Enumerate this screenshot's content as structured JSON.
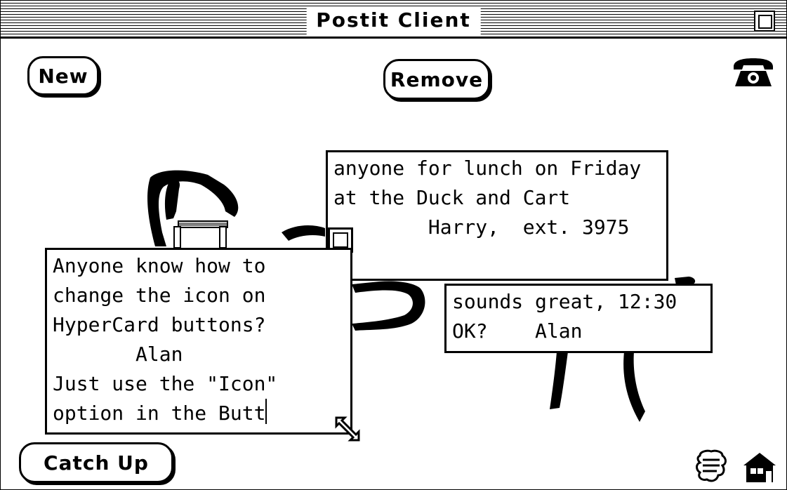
{
  "window": {
    "title": "Postit Client"
  },
  "toolbar": {
    "new_label": "New",
    "remove_label": "Remove",
    "catch_up_label": "Catch Up"
  },
  "notes": [
    {
      "id": "lunch",
      "lines": [
        "anyone for lunch on Friday",
        "at the Duck and Cart",
        "        Harry,  ext. 3975"
      ]
    },
    {
      "id": "icon",
      "lines": [
        "Anyone know how to",
        "change the icon on",
        "HyperCard buttons?",
        "       Alan",
        "Just use the \"Icon\"",
        "option in the Butt"
      ]
    },
    {
      "id": "reply",
      "lines": [
        "sounds great, 12:30",
        "OK?    Alan"
      ]
    }
  ],
  "icons": {
    "phone": "telephone-icon",
    "script": "script-icon",
    "home": "home-icon",
    "zoom": "zoom-box-icon",
    "close": "close-box-icon",
    "resize": "resize-arrow-icon"
  }
}
